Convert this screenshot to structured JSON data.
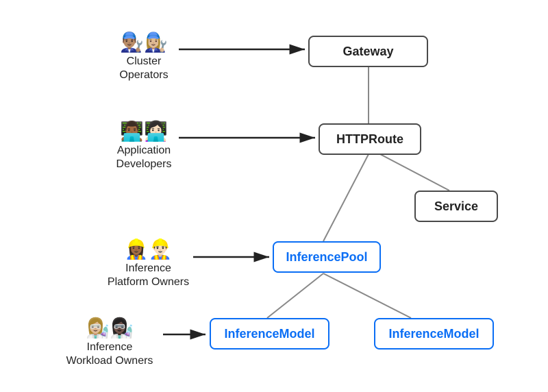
{
  "diagram": {
    "nodes": {
      "gateway": "Gateway",
      "httproute": "HTTPRoute",
      "service": "Service",
      "inferencepool": "InferencePool",
      "inferencemodel_left": "InferenceModel",
      "inferencemodel_right": "InferenceModel"
    },
    "roles": {
      "cluster_operators": {
        "emoji": "👨🏽‍🔧👩🏼‍🔧",
        "line1": "Cluster",
        "line2": "Operators"
      },
      "app_developers": {
        "emoji": "👨🏾‍💻👩🏻‍💻",
        "line1": "Application",
        "line2": "Developers"
      },
      "platform_owners": {
        "emoji": "👷🏾‍♀️👷🏻‍♂️",
        "line1": "Inference",
        "line2": "Platform Owners"
      },
      "workload_owners": {
        "emoji": "👩🏼‍🔬👩🏿‍🔬",
        "line1": "Inference",
        "line2": "Workload Owners"
      }
    }
  }
}
